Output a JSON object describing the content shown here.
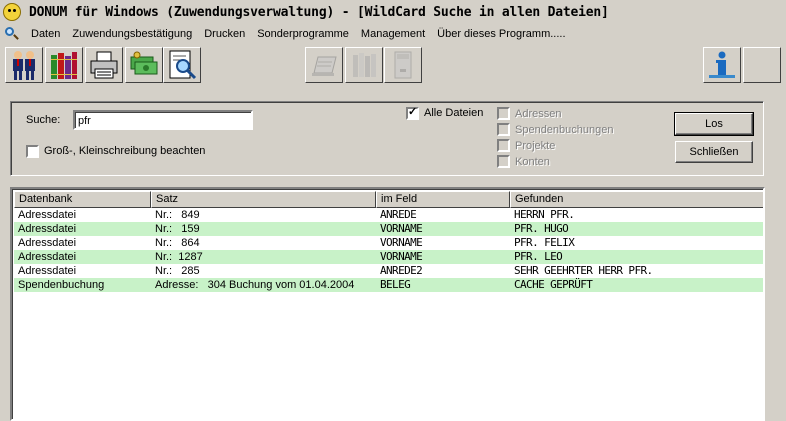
{
  "window": {
    "title": "DONUM für Windows (Zuwendungsverwaltung) - [WildCard Suche in allen Dateien]"
  },
  "menu": [
    "Daten",
    "Zuwendungsbestätigung",
    "Drucken",
    "Sonderprogramme",
    "Management",
    "Über dieses Programm....."
  ],
  "toolbar": {
    "buttons": [
      {
        "icon": "people-icon",
        "enabled": true
      },
      {
        "icon": "books-icon",
        "enabled": true
      },
      {
        "icon": "printer-icon",
        "enabled": true
      },
      {
        "icon": "money-icon",
        "enabled": true
      },
      {
        "icon": "search-document-icon",
        "enabled": true
      },
      {
        "icon": "document-icon",
        "enabled": false
      },
      {
        "icon": "books-disabled-icon",
        "enabled": false
      },
      {
        "icon": "calculator-icon",
        "enabled": false
      },
      {
        "icon": "info-icon",
        "enabled": true
      },
      {
        "icon": "blank",
        "enabled": true
      }
    ]
  },
  "search": {
    "label": "Suche:",
    "value": "pfr",
    "case_sensitive_label": "Groß-, Kleinschreibung beachten",
    "case_sensitive": false,
    "all_files_label": "Alle Dateien",
    "all_files": true,
    "options": [
      "Adressen",
      "Spendenbuchungen",
      "Projekte",
      "Konten"
    ],
    "go_label": "Los",
    "close_label": "Schließen"
  },
  "results": {
    "columns": [
      "Datenbank",
      "Satz",
      "im Feld",
      "Gefunden"
    ],
    "rows": [
      {
        "db": "Adressdatei",
        "satz": "Nr.:   849",
        "feld": "ANREDE",
        "gefunden": "HERRN PFR."
      },
      {
        "db": "Adressdatei",
        "satz": "Nr.:   159",
        "feld": "VORNAME",
        "gefunden": "PFR. HUGO"
      },
      {
        "db": "Adressdatei",
        "satz": "Nr.:   864",
        "feld": "VORNAME",
        "gefunden": "PFR. FELIX"
      },
      {
        "db": "Adressdatei",
        "satz": "Nr.:  1287",
        "feld": "VORNAME",
        "gefunden": "PFR. LEO"
      },
      {
        "db": "Adressdatei",
        "satz": "Nr.:   285",
        "feld": "ANREDE2",
        "gefunden": "SEHR GEEHRTER HERR PFR."
      },
      {
        "db": "Spendenbuchung",
        "satz": "Adresse:   304 Buchung vom 01.04.2004",
        "feld": "BELEG",
        "gefunden": "CACHE GEPRÜFT"
      }
    ]
  },
  "colors": {
    "window_bg": "#d4d0c8",
    "row_highlight": "#c8f2c8"
  }
}
